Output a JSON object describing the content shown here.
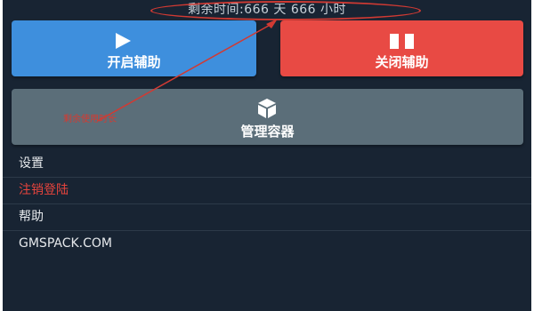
{
  "timer": {
    "text": "剩余时间:666 天 666 小时"
  },
  "buttons": {
    "start": {
      "label": "开启辅助",
      "icon": "play-icon"
    },
    "stop": {
      "label": "关闭辅助",
      "icon": "pause-icon"
    },
    "manager": {
      "label": "管理容器",
      "icon": "box-icon"
    }
  },
  "annotation": {
    "text": "剩余使用时长"
  },
  "menu": {
    "items": [
      {
        "label": "设置"
      },
      {
        "label": "注销登陆"
      },
      {
        "label": "帮助"
      },
      {
        "label": "GMSPACK.COM"
      }
    ]
  },
  "colors": {
    "background": "#182433",
    "start_button": "#3e8fdd",
    "stop_button": "#e84a44",
    "manager_button": "#5b6e79",
    "annotation": "#d13a33"
  }
}
